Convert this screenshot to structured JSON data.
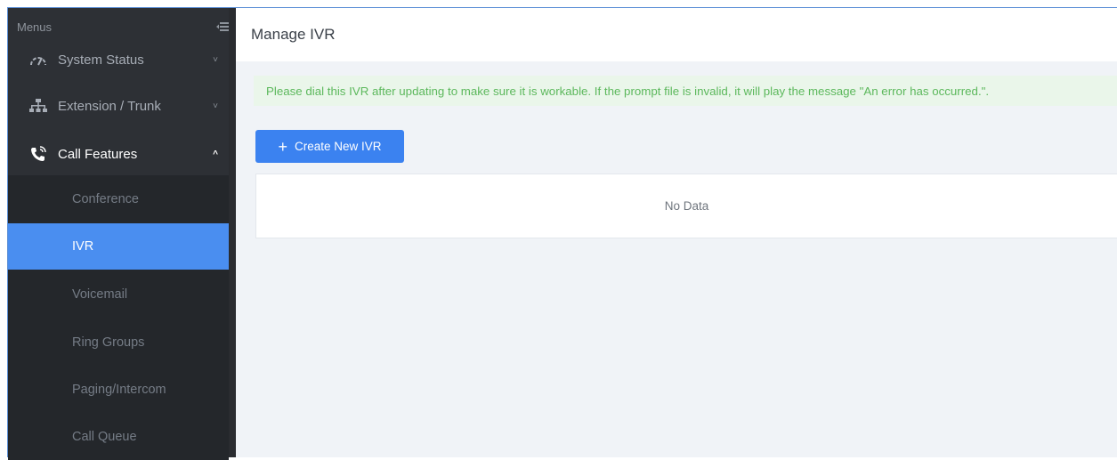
{
  "sidebar": {
    "header": "Menus",
    "items": [
      {
        "label": "System Status",
        "icon": "gauge-icon",
        "chevron": "˅"
      },
      {
        "label": "Extension / Trunk",
        "icon": "network-icon",
        "chevron": "˅"
      },
      {
        "label": "Call Features",
        "icon": "phone-call-icon",
        "chevron": "^"
      }
    ],
    "submenu": [
      {
        "label": "Conference"
      },
      {
        "label": "IVR"
      },
      {
        "label": "Voicemail"
      },
      {
        "label": "Ring Groups"
      },
      {
        "label": "Paging/Intercom"
      },
      {
        "label": "Call Queue"
      }
    ]
  },
  "main": {
    "title": "Manage IVR",
    "notice": "Please dial this IVR after updating to make sure it is workable. If the prompt file is invalid, it will play the message \"An error has occurred.\".",
    "create_button": "Create New IVR",
    "create_button_icon": "+",
    "empty_text": "No Data"
  },
  "colors": {
    "sidebar_bg": "#2d3035",
    "active_item": "#4a8ef0",
    "primary_button": "#3b82f0",
    "notice_text": "#5cb85c",
    "notice_bg": "#eaf6ea"
  }
}
